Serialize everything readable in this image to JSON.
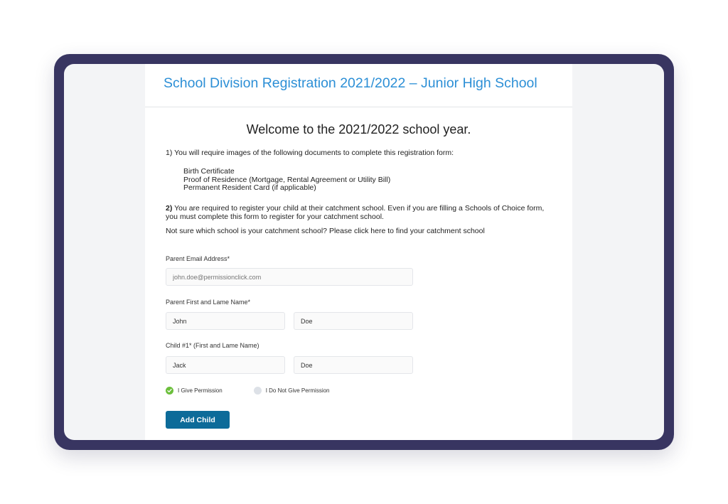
{
  "form": {
    "title": "School Division Registration 2021/2022 – Junior High School",
    "welcome": "Welcome to the 2021/2022 school year.",
    "step1": "1) You will require images of the following documents to complete this registration form:",
    "documents": [
      "Birth Certificate",
      "Proof of Residence (Mortgage, Rental Agreement or Utility Bill)",
      "Permanent Resident Card (if applicable)"
    ],
    "step2_number": "2)",
    "step2_text": " You are required to register your child at their catchment school. Even if you are filling a Schools of Choice form, you must complete this form to register for your catchment school.",
    "catchment": "Not sure which school is your catchment school?  Please click here to find your catchment school"
  },
  "fields": {
    "email_label": "Parent Email Address*",
    "email_placeholder": "john.doe@permissionclick.com",
    "parent_label": "Parent First and Lame Name*",
    "parent_first": "John",
    "parent_last": "Doe",
    "child_label": "Child #1* (First and Lame Name)",
    "child_first": "Jack",
    "child_last": "Doe"
  },
  "permission": {
    "give": "I Give Permission",
    "not_give": "I Do Not Give Permission",
    "selected": "give"
  },
  "actions": {
    "add_child": "Add Child"
  },
  "colors": {
    "device_frame": "#383561",
    "title_blue": "#2c8fd6",
    "button_blue": "#0d6b99",
    "check_green": "#6cbf3c"
  }
}
